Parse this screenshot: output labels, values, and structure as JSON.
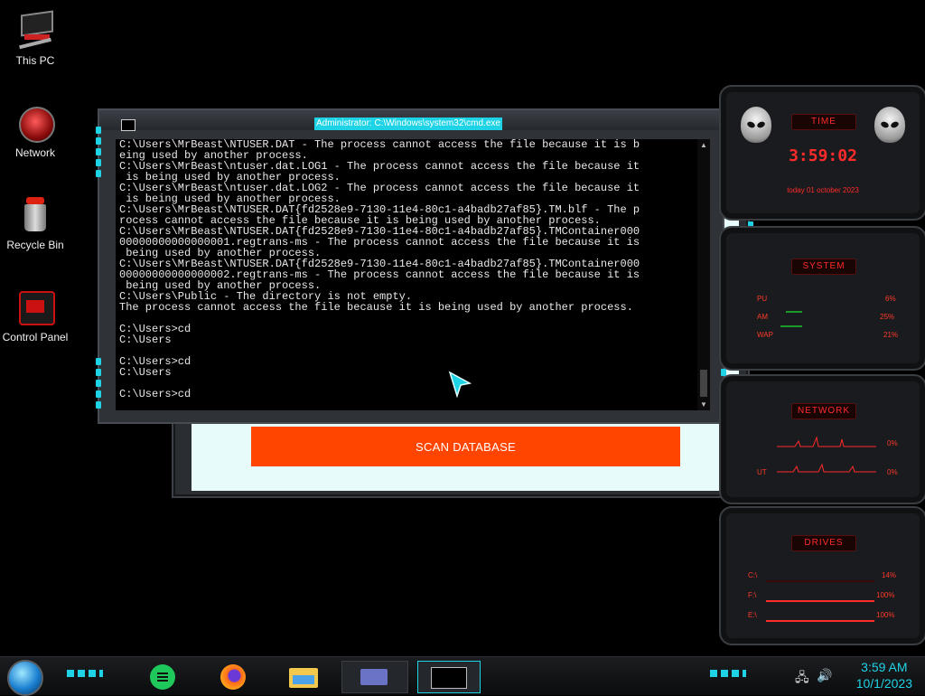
{
  "desktop_icons": [
    {
      "label": "This PC"
    },
    {
      "label": "Network"
    },
    {
      "label": "Recycle Bin"
    },
    {
      "label": "Control Panel"
    }
  ],
  "scan_app": {
    "button_label": "SCAN DATABASE",
    "accent_color": "#ff4500"
  },
  "cmd": {
    "title": "Administrator: C:\\Windows\\system32\\cmd.exe",
    "lines": [
      "C:\\Users\\MrBeast\\NTUSER.DAT - The process cannot access the file because it is b",
      "eing used by another process.",
      "C:\\Users\\MrBeast\\ntuser.dat.LOG1 - The process cannot access the file because it",
      " is being used by another process.",
      "C:\\Users\\MrBeast\\ntuser.dat.LOG2 - The process cannot access the file because it",
      " is being used by another process.",
      "C:\\Users\\MrBeast\\NTUSER.DAT{fd2528e9-7130-11e4-80c1-a4badb27af85}.TM.blf - The p",
      "rocess cannot access the file because it is being used by another process.",
      "C:\\Users\\MrBeast\\NTUSER.DAT{fd2528e9-7130-11e4-80c1-a4badb27af85}.TMContainer000",
      "00000000000000001.regtrans-ms - The process cannot access the file because it is",
      " being used by another process.",
      "C:\\Users\\MrBeast\\NTUSER.DAT{fd2528e9-7130-11e4-80c1-a4badb27af85}.TMContainer000",
      "00000000000000002.regtrans-ms - The process cannot access the file because it is",
      " being used by another process.",
      "C:\\Users\\Public - The directory is not empty.",
      "The process cannot access the file because it is being used by another process.",
      "",
      "C:\\Users>cd",
      "C:\\Users",
      "",
      "C:\\Users>cd",
      "C:\\Users",
      "",
      "C:\\Users>cd"
    ]
  },
  "gadgets": {
    "time": {
      "title": "TIME",
      "clock": "3:59:02",
      "date": "today 01 october 2023"
    },
    "system": {
      "title": "SYSTEM",
      "rows": [
        {
          "label": "PU",
          "value": "6%"
        },
        {
          "label": "AM",
          "value": "25%"
        },
        {
          "label": "WAP",
          "value": "21%"
        }
      ]
    },
    "network": {
      "title": "NETWORK",
      "rows": [
        {
          "label": "",
          "value": "0%"
        },
        {
          "label": "UT",
          "value": "0%"
        }
      ]
    },
    "drives": {
      "title": "DRIVES",
      "rows": [
        {
          "label": "C:\\",
          "value": "14%"
        },
        {
          "label": "F:\\",
          "value": "100%"
        },
        {
          "label": "E:\\",
          "value": "100%"
        }
      ]
    },
    "accent_color": "#ff2a2a"
  },
  "taskbar": {
    "start": "start-orb",
    "apps": [
      "notes-icon",
      "firefox-icon",
      "file-explorer-icon",
      "app-window-icon",
      "terminal-icon"
    ],
    "tray_icons": [
      "network-icon",
      "volume-icon"
    ],
    "time": "3:59 AM",
    "date": "10/1/2023",
    "accent_color": "#1fd3e6"
  }
}
